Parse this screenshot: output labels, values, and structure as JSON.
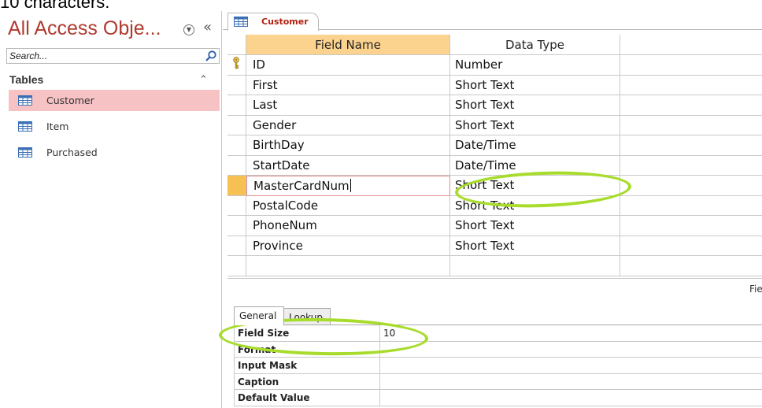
{
  "caption": {
    "text": "10 characters."
  },
  "nav": {
    "title": "All Access Obje...",
    "search_placeholder": "Search...",
    "group_label": "Tables",
    "items": [
      {
        "label": "Customer",
        "selected": true
      },
      {
        "label": "Item",
        "selected": false
      },
      {
        "label": "Purchased",
        "selected": false
      }
    ]
  },
  "doc": {
    "tab_label": "Customer",
    "columns": {
      "field_name": "Field Name",
      "data_type": "Data Type"
    },
    "rows": [
      {
        "field": "ID",
        "type": "Number",
        "primary_key": true
      },
      {
        "field": "First",
        "type": "Short Text"
      },
      {
        "field": "Last",
        "type": "Short Text"
      },
      {
        "field": "Gender",
        "type": "Short Text"
      },
      {
        "field": "BirthDay",
        "type": "Date/Time"
      },
      {
        "field": "StartDate",
        "type": "Date/Time"
      },
      {
        "field": "MasterCardNum",
        "type": "Short Text",
        "editing": true
      },
      {
        "field": "PostalCode",
        "type": "Short Text"
      },
      {
        "field": "PhoneNum",
        "type": "Short Text"
      },
      {
        "field": "Province",
        "type": "Short Text"
      }
    ],
    "properties_label": "Fie"
  },
  "properties": {
    "tabs": {
      "general": "General",
      "lookup": "Lookup"
    },
    "rows": [
      {
        "label": "Field Size",
        "value": "10"
      },
      {
        "label": "Format",
        "value": ""
      },
      {
        "label": "Input Mask",
        "value": ""
      },
      {
        "label": "Caption",
        "value": ""
      },
      {
        "label": "Default Value",
        "value": ""
      }
    ]
  },
  "colors": {
    "nav_title": "#b03a2e",
    "nav_selected": "#f7c2c4",
    "header_highlight": "#fbd28e",
    "row_selector_active": "#f6c053",
    "annotation": "#a8dc2c"
  }
}
